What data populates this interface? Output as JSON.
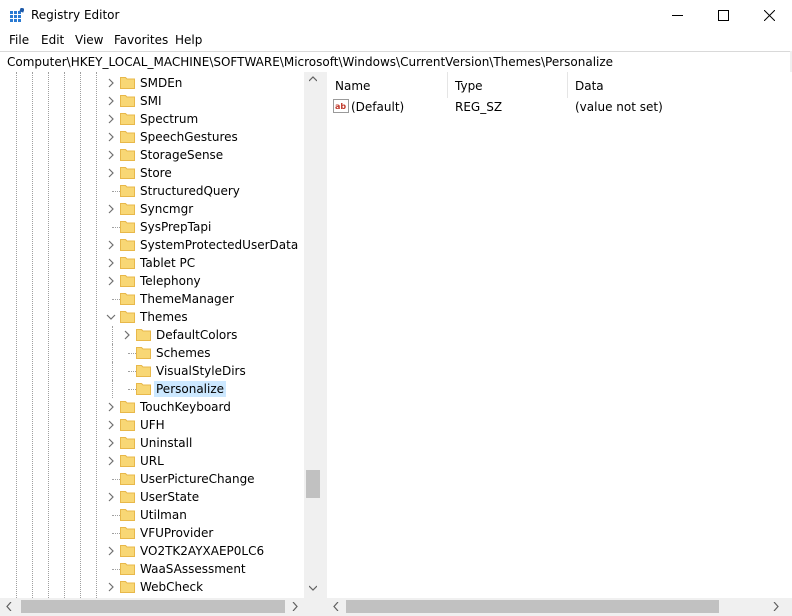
{
  "window": {
    "title": "Registry Editor",
    "buttons": {
      "minimize": "minimize",
      "maximize": "maximize",
      "close": "close"
    }
  },
  "menu": [
    "File",
    "Edit",
    "View",
    "Favorites",
    "Help"
  ],
  "address": "Computer\\HKEY_LOCAL_MACHINE\\SOFTWARE\\Microsoft\\Windows\\CurrentVersion\\Themes\\Personalize",
  "tree": [
    {
      "label": "SMDEn",
      "depth": 0,
      "expander": "collapsed"
    },
    {
      "label": "SMI",
      "depth": 0,
      "expander": "collapsed"
    },
    {
      "label": "Spectrum",
      "depth": 0,
      "expander": "collapsed"
    },
    {
      "label": "SpeechGestures",
      "depth": 0,
      "expander": "collapsed"
    },
    {
      "label": "StorageSense",
      "depth": 0,
      "expander": "collapsed"
    },
    {
      "label": "Store",
      "depth": 0,
      "expander": "collapsed"
    },
    {
      "label": "StructuredQuery",
      "depth": 0,
      "expander": "none"
    },
    {
      "label": "Syncmgr",
      "depth": 0,
      "expander": "collapsed"
    },
    {
      "label": "SysPrepTapi",
      "depth": 0,
      "expander": "none"
    },
    {
      "label": "SystemProtectedUserData",
      "depth": 0,
      "expander": "collapsed"
    },
    {
      "label": "Tablet PC",
      "depth": 0,
      "expander": "collapsed"
    },
    {
      "label": "Telephony",
      "depth": 0,
      "expander": "collapsed"
    },
    {
      "label": "ThemeManager",
      "depth": 0,
      "expander": "none"
    },
    {
      "label": "Themes",
      "depth": 0,
      "expander": "expanded"
    },
    {
      "label": "DefaultColors",
      "depth": 1,
      "expander": "collapsed"
    },
    {
      "label": "Schemes",
      "depth": 1,
      "expander": "none"
    },
    {
      "label": "VisualStyleDirs",
      "depth": 1,
      "expander": "none"
    },
    {
      "label": "Personalize",
      "depth": 1,
      "expander": "none",
      "selected": true
    },
    {
      "label": "TouchKeyboard",
      "depth": 0,
      "expander": "collapsed"
    },
    {
      "label": "UFH",
      "depth": 0,
      "expander": "collapsed"
    },
    {
      "label": "Uninstall",
      "depth": 0,
      "expander": "collapsed"
    },
    {
      "label": "URL",
      "depth": 0,
      "expander": "collapsed"
    },
    {
      "label": "UserPictureChange",
      "depth": 0,
      "expander": "none"
    },
    {
      "label": "UserState",
      "depth": 0,
      "expander": "collapsed"
    },
    {
      "label": "Utilman",
      "depth": 0,
      "expander": "none"
    },
    {
      "label": "VFUProvider",
      "depth": 0,
      "expander": "none"
    },
    {
      "label": "VO2TK2AYXAEP0LC6",
      "depth": 0,
      "expander": "collapsed"
    },
    {
      "label": "WaaSAssessment",
      "depth": 0,
      "expander": "none"
    },
    {
      "label": "WebCheck",
      "depth": 0,
      "expander": "collapsed"
    }
  ],
  "list": {
    "columns": [
      "Name",
      "Type",
      "Data"
    ],
    "rows": [
      {
        "name": "(Default)",
        "type": "REG_SZ",
        "data": "(value not set)",
        "icon": "string-value-icon"
      }
    ]
  },
  "colors": {
    "selection": "#cce8ff",
    "folder": "#f8d775",
    "folder_dark": "#e8b84a"
  }
}
